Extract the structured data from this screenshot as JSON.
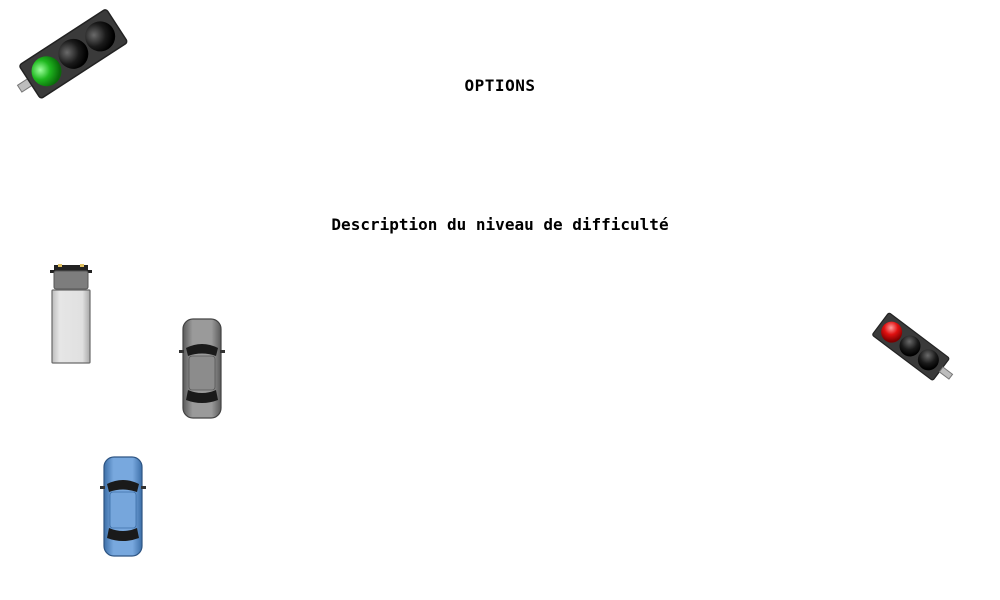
{
  "screen": {
    "title": "OPTIONS",
    "description": "Description du niveau de difficulté"
  },
  "sprites": {
    "traffic_light_top_left": {
      "icon": "traffic-light-icon",
      "active_light": "green"
    },
    "traffic_light_right": {
      "icon": "traffic-light-icon",
      "active_light": "red"
    },
    "truck": {
      "icon": "truck-icon",
      "color": "#d8d8d8"
    },
    "car_gray": {
      "icon": "car-icon",
      "color": "#8a8a8a"
    },
    "car_blue": {
      "icon": "car-icon",
      "color": "#6f9fd6"
    }
  },
  "colors": {
    "background": "#ffffff",
    "text": "#000000",
    "light_green": "#1fb81f",
    "light_red": "#e01010",
    "light_off": "#151515",
    "housing": "#3a3a3a"
  }
}
